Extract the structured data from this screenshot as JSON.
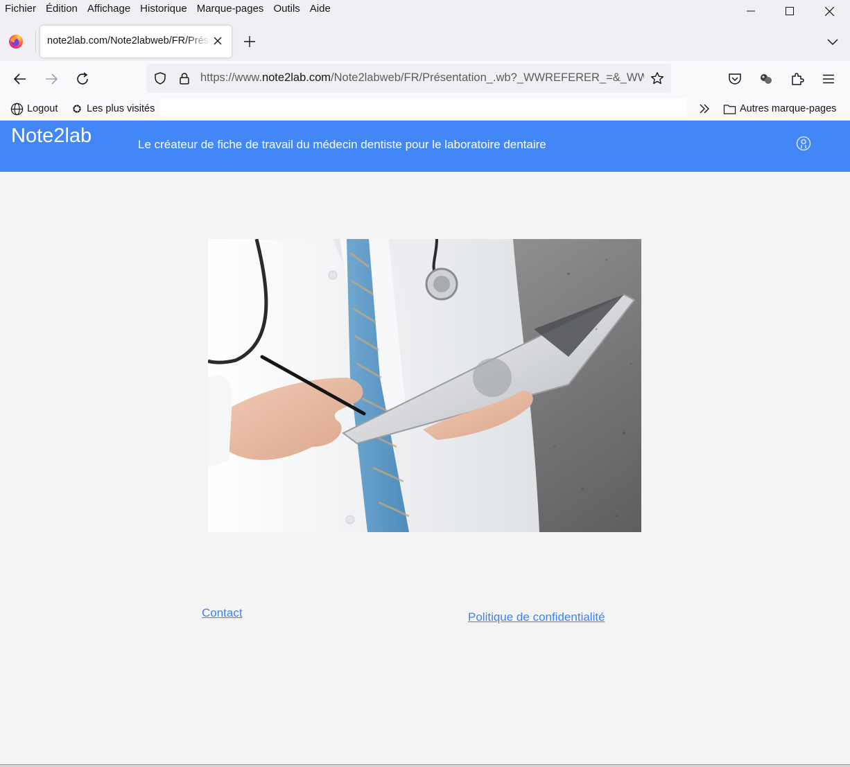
{
  "menubar": {
    "items": [
      "Fichier",
      "Édition",
      "Affichage",
      "Historique",
      "Marque-pages",
      "Outils",
      "Aide"
    ]
  },
  "tab": {
    "title": "note2lab.com/Note2labweb/FR/Présentation_.wb?_WWREFERER_=&_WW"
  },
  "urlbar": {
    "scheme": "https://www.",
    "host": "note2lab.com",
    "path": "/Note2labweb/FR/Présentation_.wb?_WWREFERER_=&_WW"
  },
  "bookmarks": {
    "logout": "Logout",
    "most_visited": "Les plus visités",
    "other": "Autres marque-pages"
  },
  "site": {
    "logo": "Note2lab",
    "tagline": "Le créateur de fiche de travail du médecin dentiste pour le laboratoire dentaire",
    "accent_color": "#4287f5"
  },
  "footer": {
    "contact": "Contact",
    "privacy": "Politique de confidentialité"
  }
}
